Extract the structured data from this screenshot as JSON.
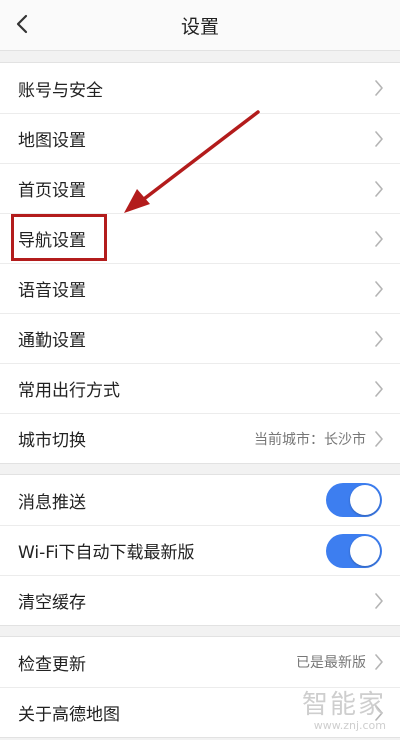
{
  "header": {
    "title": "设置"
  },
  "groups": [
    {
      "items": [
        {
          "label": "账号与安全"
        },
        {
          "label": "地图设置"
        },
        {
          "label": "首页设置"
        },
        {
          "label": "导航设置"
        },
        {
          "label": "语音设置"
        },
        {
          "label": "通勤设置"
        },
        {
          "label": "常用出行方式"
        },
        {
          "label": "城市切换",
          "value": "当前城市：长沙市"
        }
      ]
    },
    {
      "items": [
        {
          "label": "消息推送",
          "toggle": true
        },
        {
          "label": "Wi-Fi下自动下载最新版",
          "toggle": true
        },
        {
          "label": "清空缓存"
        }
      ]
    },
    {
      "items": [
        {
          "label": "检查更新",
          "value": "已是最新版"
        },
        {
          "label": "关于高德地图"
        }
      ]
    }
  ],
  "annotation": {
    "color": "#b31c1c"
  },
  "toggle_color": "#3d7ef0",
  "watermark": {
    "main": "智能家",
    "sub": "www.znj.com"
  }
}
